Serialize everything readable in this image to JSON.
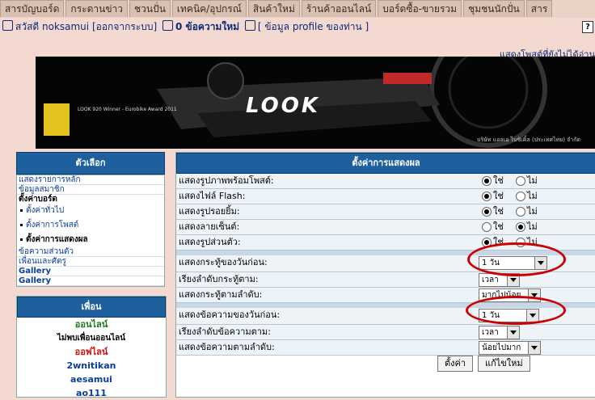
{
  "tabs": [
    "สารบัญบอร์ด",
    "กระดานข่าว",
    "ชวนปั่น",
    "เทคนิค/อุปกรณ์",
    "สินค้าใหม่",
    "ร้านค้าออนไลน์",
    "บอร์ดซื้อ-ขายรวม",
    "ชุมชนนักปั่น",
    "สาร"
  ],
  "userbar": {
    "greeting": "สวัสดี noksamui",
    "logout": "[ออกจากระบบ]",
    "new_messages": "0 ข้อความใหม่",
    "profile": "[ ข้อมูล profile ของท่าน ]",
    "help": "?"
  },
  "unread_link": "แสดงโพสต์ที่ยังไม่ได้อ่าน",
  "banner": {
    "logo": "LOOK",
    "award": "LOOK 920 Winner - Eurobike Award 2011",
    "credit": "บริษัท แอลเอ ไบซิเคิ้ล (ประเทศไทย) จำกัด"
  },
  "sidebar": {
    "title": "ตัวเลือก",
    "items_top": [
      "แสดงรายการหลัก",
      "ข้อมูลสมาชิก"
    ],
    "board_settings": "ตั้งค่าบอร์ด",
    "sub_items": [
      "ตั้งค่าทั่วไป",
      "ตั้งค่าการโพสต์",
      "ตั้งค่าการแสดงผล"
    ],
    "items_bottom": [
      "ข้อความส่วนตัว",
      "เพื่อนและศัตรู",
      "Gallery",
      "Gallery"
    ]
  },
  "friends": {
    "title": "เพื่อน",
    "online_label": "ออนไลน์",
    "no_friends_online": "ไม่พบเพื่อนออนไลน์",
    "offline_label": "ออฟไลน์",
    "offline_list": [
      "2wnitikan",
      "aesamui",
      "ao111"
    ]
  },
  "main": {
    "title": "ตั้งค่าการแสดงผล",
    "yes": "ใช่",
    "no": "ไม่",
    "radio_rows": [
      {
        "label": "แสดงรูปภาพพร้อมโพสต์:",
        "value": "yes"
      },
      {
        "label": "แสดงไฟล์ Flash:",
        "value": "yes"
      },
      {
        "label": "แสดงรูปรอยยิ้ม:",
        "value": "yes"
      },
      {
        "label": "แสดงลายเซ็นต์:",
        "value": "no"
      },
      {
        "label": "แสดงรูปส่วนตัว:",
        "value": "yes"
      }
    ],
    "select_rows": [
      {
        "label": "แสดงกระทู้ของวันก่อน:",
        "value": "1 วัน"
      },
      {
        "label": "เรียงลำดับกระทู้ตาม:",
        "value": "เวลา"
      },
      {
        "label": "แสดงกระทู้ตามลำดับ:",
        "value": "มากไปน้อย"
      },
      {
        "label": "แสดงข้อความของวันก่อน:",
        "value": "1 วัน"
      },
      {
        "label": "เรียงลำดับข้อความตาม:",
        "value": "เวลา"
      },
      {
        "label": "แสดงข้อความตามลำดับ:",
        "value": "น้อยไปมาก"
      }
    ],
    "submit": "ตั้งค่า",
    "reset": "แก้ไขใหม่"
  },
  "colors": {
    "panel_header": "#1e5f9e",
    "background": "#f3d9d0",
    "annotation": "#cc0000"
  }
}
